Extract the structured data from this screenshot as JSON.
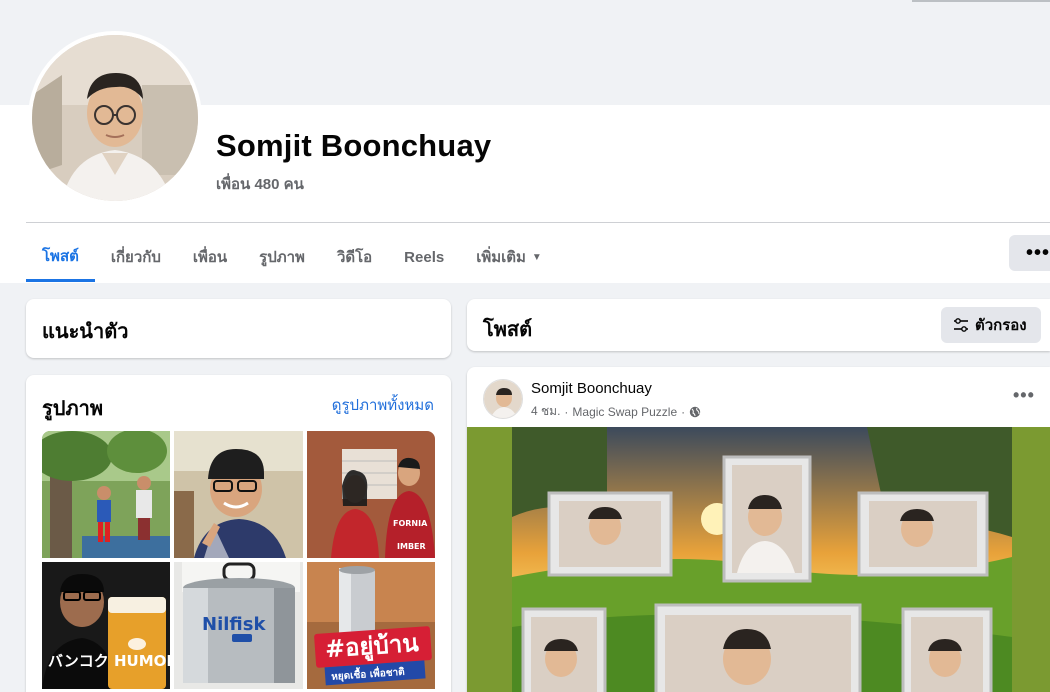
{
  "profile": {
    "name": "Somjit Boonchuay",
    "friends": "เพื่อน 480 คน"
  },
  "tabs": [
    {
      "label": "โพสต์",
      "active": true
    },
    {
      "label": "เกี่ยวกับ",
      "active": false
    },
    {
      "label": "เพื่อน",
      "active": false
    },
    {
      "label": "รูปภาพ",
      "active": false
    },
    {
      "label": "วิดีโอ",
      "active": false
    },
    {
      "label": "Reels",
      "active": false
    },
    {
      "label": "เพิ่มเติม",
      "active": false
    }
  ],
  "more_button": "•••",
  "intro": {
    "title": "แนะนำตัว"
  },
  "photos": {
    "title": "รูปภาพ",
    "see_all": "ดูรูปภาพทั้งหมด",
    "items": [
      {
        "name": "photo-garden"
      },
      {
        "name": "photo-selfie"
      },
      {
        "name": "photo-couple"
      },
      {
        "name": "photo-beer",
        "text": "バンコク HUMOR"
      },
      {
        "name": "photo-nilfisk",
        "text": "Nilfisk"
      },
      {
        "name": "photo-stay-home",
        "text": "#อยู่บ้าน",
        "subtext": "หยุดเชื้อ เพื่อชาติ"
      }
    ]
  },
  "posts_header": {
    "title": "โพสต์",
    "filter_label": "ตัวกรอง"
  },
  "post": {
    "author": "Somjit Boonchuay",
    "time": "4 ชม.",
    "app": "Magic Swap Puzzle",
    "more": "•••"
  },
  "colors": {
    "accent": "#1b74e4",
    "link": "#216fdb",
    "secondary_text": "#65676b",
    "background": "#f0f2f5"
  }
}
